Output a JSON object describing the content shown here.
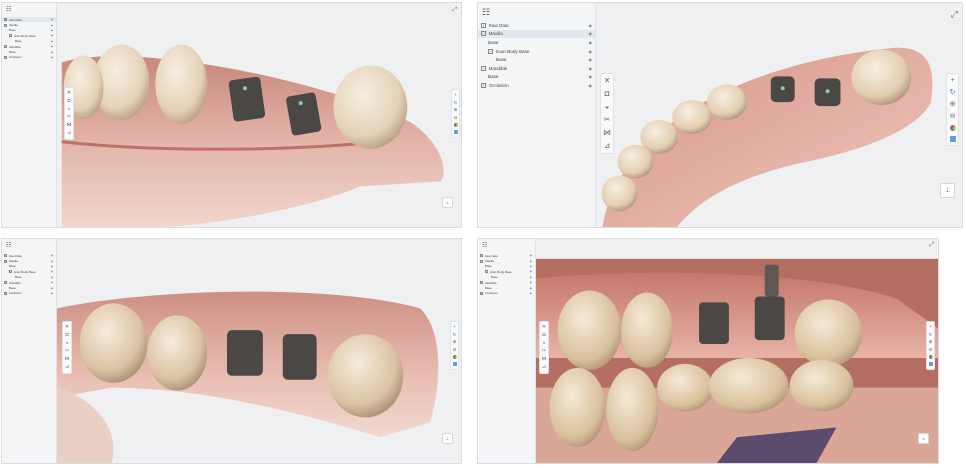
{
  "views": [
    {
      "id": "view-1",
      "tree": [
        {
          "label": "Raw Data",
          "level": 0,
          "toggle": "+",
          "selected": true
        },
        {
          "label": "Maxilla",
          "level": 0,
          "toggle": "−"
        },
        {
          "label": "Base",
          "level": 1
        },
        {
          "label": "Scan Body Base",
          "level": 1,
          "toggle": "−"
        },
        {
          "label": "Base",
          "level": 2
        },
        {
          "label": "Mandible",
          "level": 0,
          "toggle": "−"
        },
        {
          "label": "Base",
          "level": 1
        },
        {
          "label": "Occlusion",
          "level": 0,
          "toggle": "+"
        }
      ]
    },
    {
      "id": "view-2",
      "tree": [
        {
          "label": "Raw Data",
          "level": 0,
          "toggle": "+"
        },
        {
          "label": "Maxilla",
          "level": 0,
          "toggle": "−",
          "selected": true
        },
        {
          "label": "Base",
          "level": 1
        },
        {
          "label": "Scan Body Base",
          "level": 1,
          "toggle": "−"
        },
        {
          "label": "Base",
          "level": 2
        },
        {
          "label": "Mandible",
          "level": 0,
          "toggle": "−"
        },
        {
          "label": "Base",
          "level": 1
        },
        {
          "label": "Occlusion",
          "level": 0,
          "toggle": "+"
        }
      ]
    },
    {
      "id": "view-3",
      "tree": [
        {
          "label": "Raw Data",
          "level": 0,
          "toggle": "+"
        },
        {
          "label": "Maxilla",
          "level": 0,
          "toggle": "−"
        },
        {
          "label": "Base",
          "level": 1
        },
        {
          "label": "Scan Body Base",
          "level": 1,
          "toggle": "−"
        },
        {
          "label": "Base",
          "level": 2
        },
        {
          "label": "Mandible",
          "level": 0,
          "toggle": "−"
        },
        {
          "label": "Base",
          "level": 1
        },
        {
          "label": "Occlusion",
          "level": 0,
          "toggle": "+"
        }
      ]
    },
    {
      "id": "view-4",
      "tree": [
        {
          "label": "Raw Data",
          "level": 0,
          "toggle": "+"
        },
        {
          "label": "Maxilla",
          "level": 0,
          "toggle": "−"
        },
        {
          "label": "Base",
          "level": 1
        },
        {
          "label": "Scan Body Base",
          "level": 1,
          "toggle": "−"
        },
        {
          "label": "Base",
          "level": 2
        },
        {
          "label": "Mandible",
          "level": 0,
          "toggle": "−"
        },
        {
          "label": "Base",
          "level": 1
        },
        {
          "label": "Occlusion",
          "level": 0,
          "toggle": "+"
        }
      ]
    }
  ],
  "icons": {
    "panel": "☷",
    "eye": "◉",
    "lock": "⊡",
    "expand": "⤢",
    "left_tools": [
      "✕",
      "◘",
      "◒",
      "✂",
      "⋈",
      "⊿"
    ],
    "right_tools": [
      "+",
      "↻",
      "⊕",
      "⊖"
    ],
    "axis": "⊥"
  },
  "colors": {
    "accent": "#2f7de1",
    "gum": "#d99a8e",
    "tooth": "#efe3cf",
    "scan_body": "#4a4744"
  }
}
